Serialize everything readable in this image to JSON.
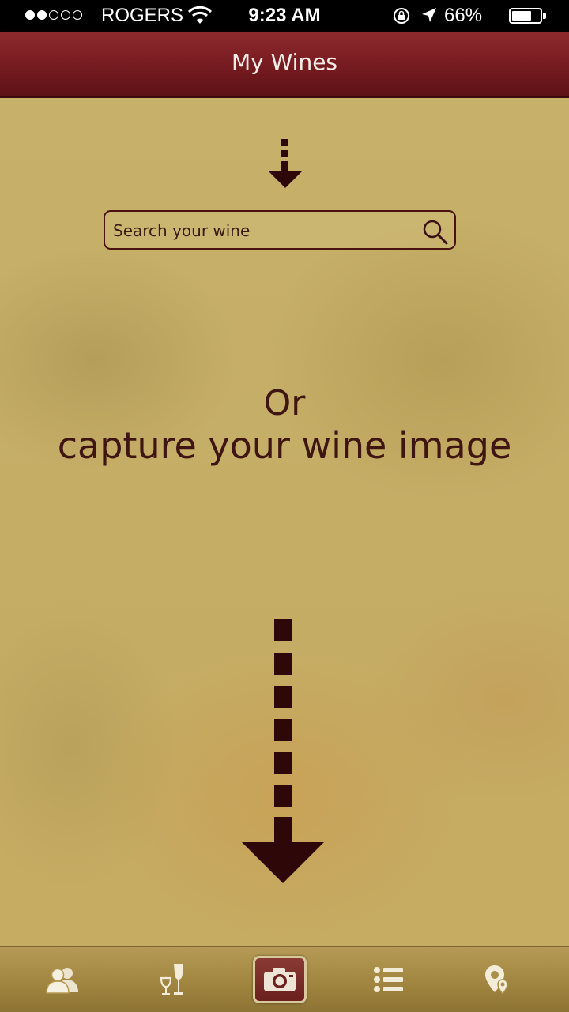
{
  "status_bar": {
    "carrier": "ROGERS",
    "time": "9:23 AM",
    "battery_percent": "66%",
    "signal_bars_filled": 2,
    "signal_bars_total": 5,
    "battery_level": 0.66
  },
  "nav": {
    "title": "My Wines"
  },
  "search": {
    "placeholder": "Search your wine"
  },
  "prompt": {
    "or": "Or",
    "capture": "capture your wine image"
  },
  "tabs": [
    {
      "icon": "people-icon",
      "active": false
    },
    {
      "icon": "wine-glasses-icon",
      "active": false
    },
    {
      "icon": "camera-icon",
      "active": true
    },
    {
      "icon": "list-icon",
      "active": false
    },
    {
      "icon": "map-pin-icon",
      "active": false
    }
  ],
  "colors": {
    "nav_bar": "#7a1d22",
    "parchment": "#c6b06a",
    "text_dark": "#3e1510",
    "tab_bar": "#a8904b"
  }
}
